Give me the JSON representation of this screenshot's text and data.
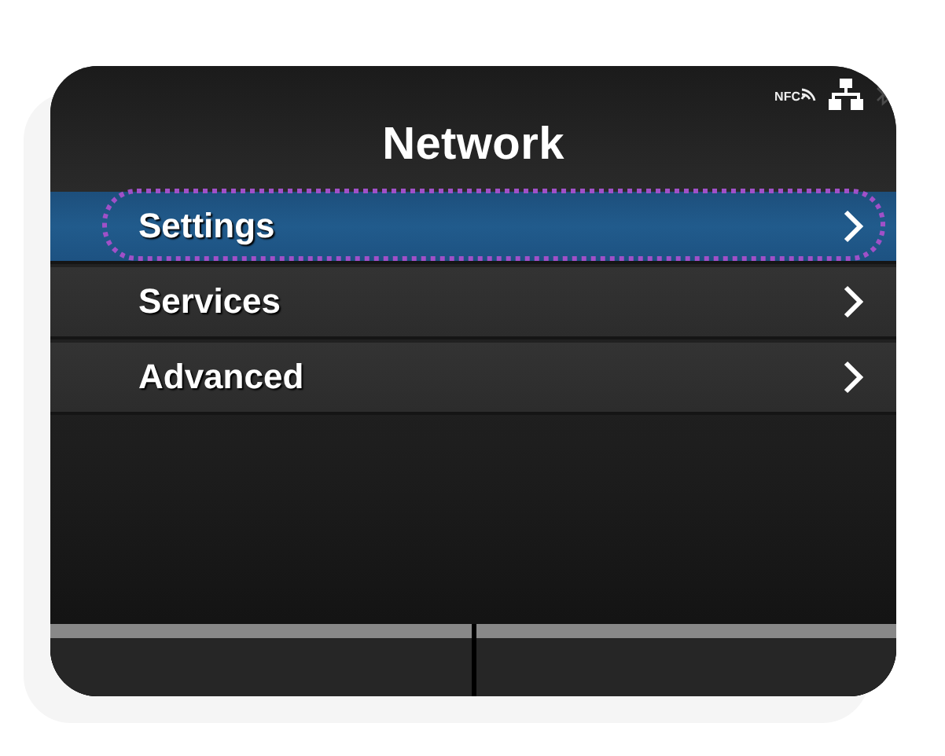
{
  "status_bar": {
    "nfc_label": "NFC",
    "bluetooth_active": false
  },
  "title": "Network",
  "menu": [
    {
      "label": "Settings",
      "selected": true
    },
    {
      "label": "Services",
      "selected": false
    },
    {
      "label": "Advanced",
      "selected": false
    }
  ]
}
